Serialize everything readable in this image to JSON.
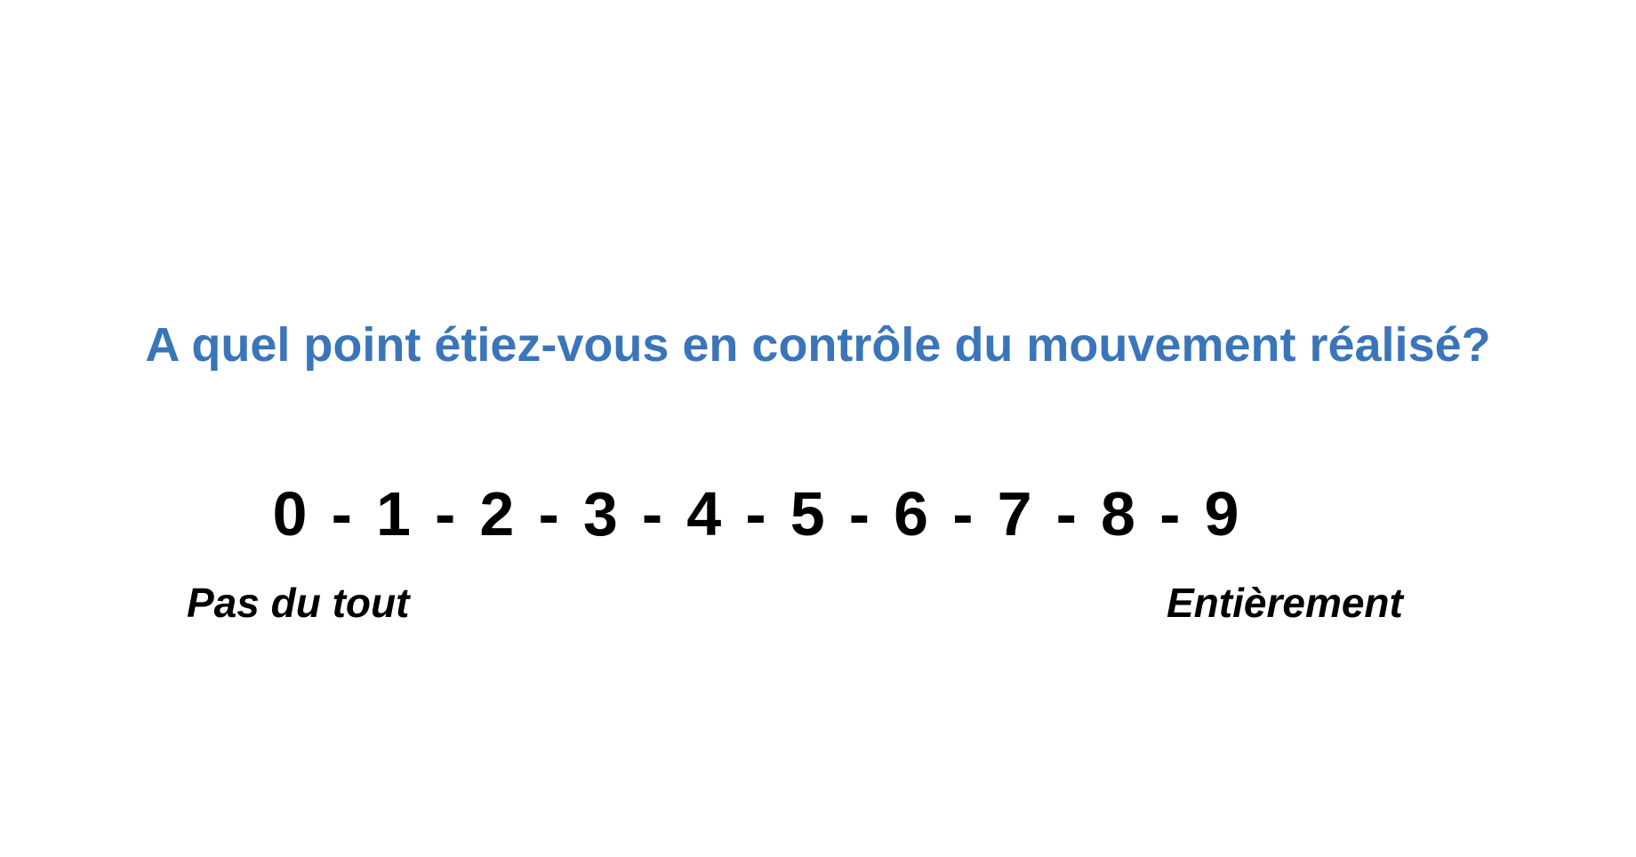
{
  "question": "A quel point étiez-vous en contrôle du mouvement réalisé?",
  "scale": {
    "values": [
      "0",
      "1",
      "2",
      "3",
      "4",
      "5",
      "6",
      "7",
      "8",
      "9"
    ],
    "separator": "-",
    "low_label": "Pas du tout",
    "high_label": "Entièrement"
  },
  "colors": {
    "question": "#3a75b9",
    "text": "#000000",
    "background": "#ffffff"
  }
}
